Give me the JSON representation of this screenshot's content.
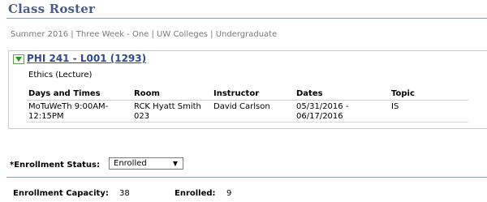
{
  "page": {
    "title": "Class Roster"
  },
  "breadcrumb": "Summer 2016 | Three Week - One | UW Colleges | Undergraduate",
  "class_section": {
    "link": "PHI 241 - L001 (1293)",
    "component": "Ethics (Lecture)",
    "headers": [
      "Days and Times",
      "Room",
      "Instructor",
      "Dates",
      "Topic"
    ],
    "row": {
      "days_times_line1": "MoTuWeTh 9:00AM-",
      "days_times_line2": "12:15PM",
      "room_line1": "RCK Hyatt Smith",
      "room_line2": "023",
      "instructor": "David Carlson",
      "dates_line1": "05/31/2016 -",
      "dates_line2": "06/17/2016",
      "topic": "IS"
    }
  },
  "enrollment_status": {
    "label": "*Enrollment Status:",
    "selected": "Enrolled"
  },
  "capacity": {
    "capacity_label": "Enrollment Capacity:",
    "capacity_value": "38",
    "enrolled_label": "Enrolled:",
    "enrolled_value": "9"
  }
}
